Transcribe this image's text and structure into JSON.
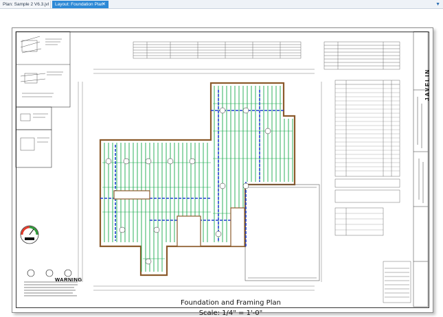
{
  "tabs": [
    {
      "label": "Plan: Sample 2 V6.3.jvl",
      "active": false
    },
    {
      "label": "Layout: Foundation Plan",
      "active": true
    }
  ],
  "tab_close_glyph": "✕",
  "tab_menu_glyph": "▼",
  "drawing": {
    "title": "Foundation and Framing Plan",
    "scale": "Scale: 1/4\" = 1'-0\"",
    "warning_label": "WARNING",
    "logo": "JAVELIN"
  },
  "colors": {
    "active_tab": "#2d89d6",
    "joist_green": "#17a84a",
    "beam_blue": "#1f3fd1",
    "wall_brown": "#8b5a2b"
  }
}
